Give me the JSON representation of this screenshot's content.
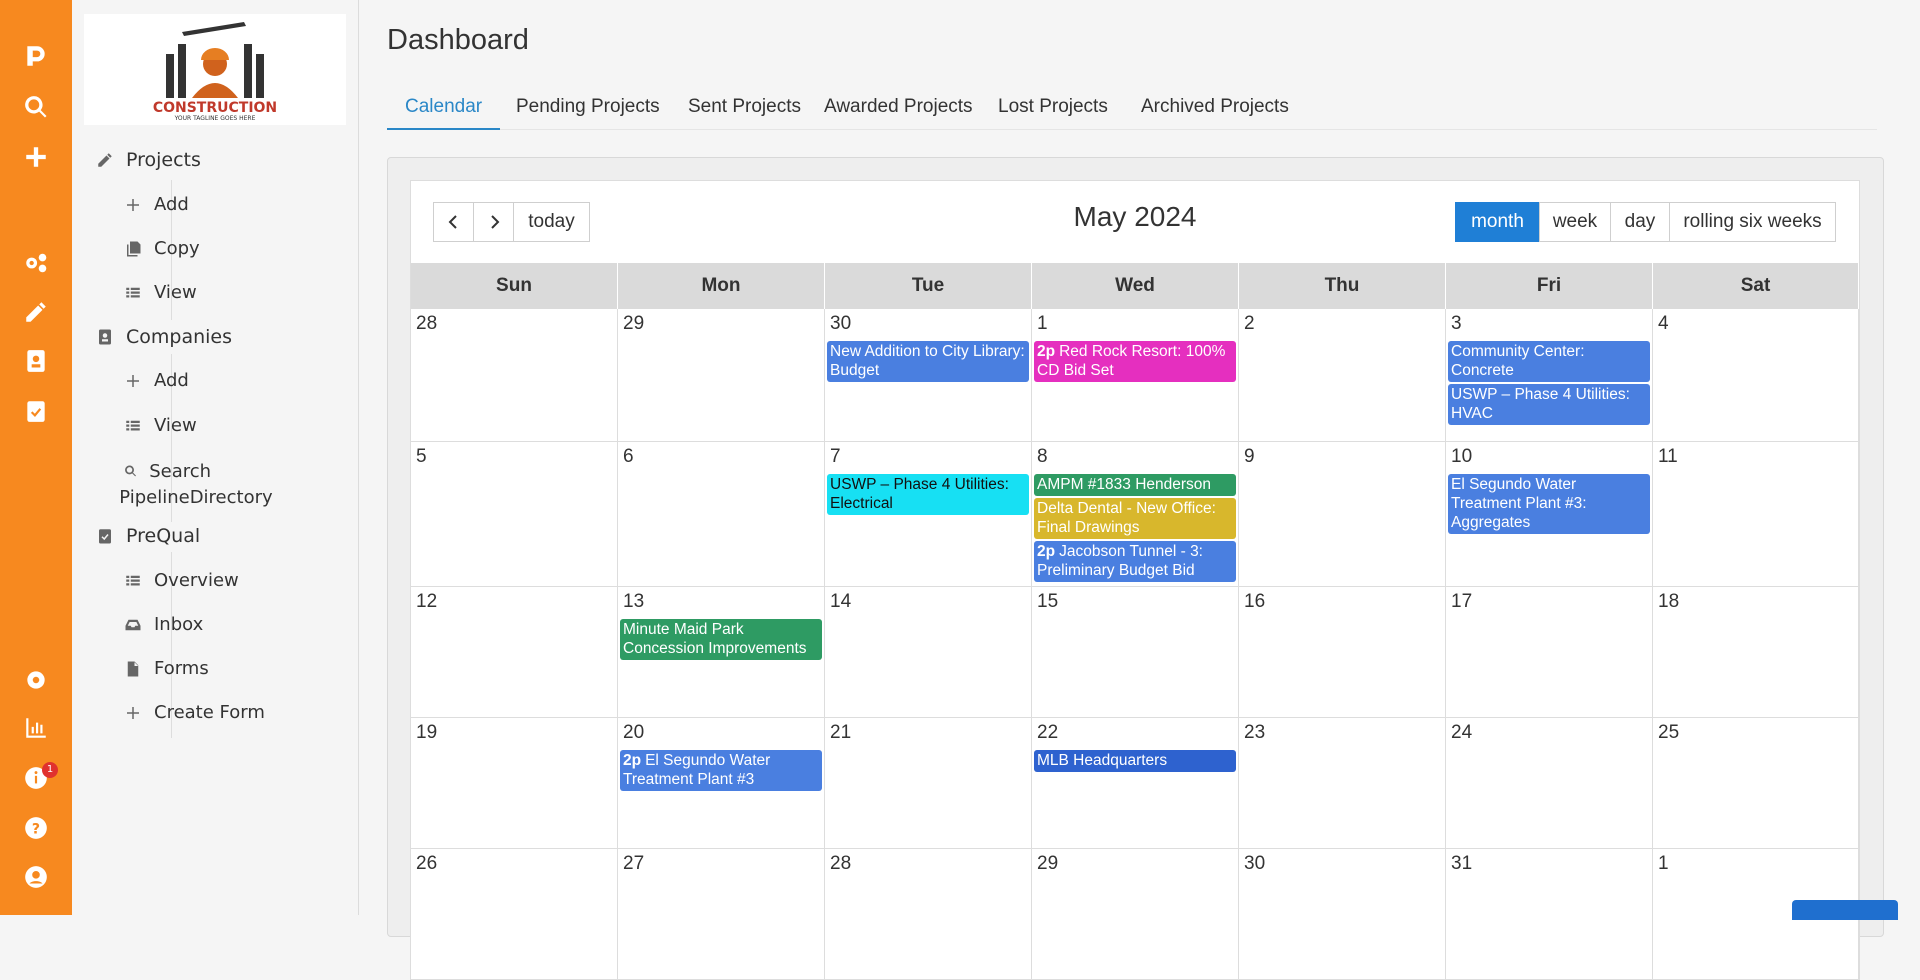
{
  "rail": {
    "icons": [
      "brand-icon",
      "search-icon",
      "plus-icon",
      "gears-icon",
      "pencil-ruler-icon",
      "contact-card-icon",
      "clipboard-check-icon",
      "settings-icon",
      "chart-icon",
      "info-icon",
      "help-icon",
      "user-icon"
    ],
    "info_badge": "1"
  },
  "logo": {
    "text": "CONSTRUCTION",
    "tagline": "YOUR TAGLINE GOES HERE"
  },
  "nav": {
    "projects": "Projects",
    "projects_add": "Add",
    "projects_copy": "Copy",
    "projects_view": "View",
    "companies": "Companies",
    "companies_add": "Add",
    "companies_view": "View",
    "companies_search": "Search PipelineDirectory",
    "prequal": "PreQual",
    "prequal_overview": "Overview",
    "prequal_inbox": "Inbox",
    "prequal_forms": "Forms",
    "prequal_create": "Create Form"
  },
  "page_title": "Dashboard",
  "tabs": [
    "Calendar",
    "Pending Projects",
    "Sent Projects",
    "Awarded Projects",
    "Lost Projects",
    "Archived Projects"
  ],
  "calendar": {
    "title": "May 2024",
    "today_label": "today",
    "views": [
      "month",
      "week",
      "day",
      "rolling six weeks"
    ],
    "days_of_week": [
      "Sun",
      "Mon",
      "Tue",
      "Wed",
      "Thu",
      "Fri",
      "Sat"
    ],
    "weeks": [
      [
        "28",
        "29",
        "30",
        "1",
        "2",
        "3",
        "4"
      ],
      [
        "5",
        "6",
        "7",
        "8",
        "9",
        "10",
        "11"
      ],
      [
        "12",
        "13",
        "14",
        "15",
        "16",
        "17",
        "18"
      ],
      [
        "19",
        "20",
        "21",
        "22",
        "23",
        "24",
        "25"
      ],
      [
        "26",
        "27",
        "28",
        "29",
        "30",
        "31",
        "1"
      ]
    ],
    "events": [
      {
        "week": 0,
        "day": 2,
        "slot": 0,
        "time": "",
        "title": "New Addition to City Library: Budget",
        "color": "#4a7fe0",
        "lines": 2
      },
      {
        "week": 0,
        "day": 3,
        "slot": 0,
        "time": "2p",
        "title": "Red Rock Resort: 100% CD Bid Set",
        "color": "#e52fbf",
        "lines": 2
      },
      {
        "week": 0,
        "day": 5,
        "slot": 0,
        "time": "",
        "title": "Community Center: Concrete",
        "color": "#4a7fe0",
        "lines": 2
      },
      {
        "week": 0,
        "day": 5,
        "slot": 1,
        "time": "",
        "title": "USWP – Phase 4 Utilities: HVAC",
        "color": "#4a7fe0",
        "lines": 2
      },
      {
        "week": 1,
        "day": 2,
        "slot": 0,
        "time": "",
        "title": "USWP – Phase 4 Utilities: Electrical",
        "color": "#17e0f3",
        "lines": 2,
        "dark": true
      },
      {
        "week": 1,
        "day": 3,
        "slot": 0,
        "time": "",
        "title": "AMPM #1833 Henderson",
        "color": "#2e9b63",
        "lines": 1
      },
      {
        "week": 1,
        "day": 3,
        "slot": 1,
        "time": "",
        "title": "Delta Dental - New Office: Final Drawings",
        "color": "#d8b72c",
        "lines": 2
      },
      {
        "week": 1,
        "day": 3,
        "slot": 2,
        "time": "2p",
        "title": "Jacobson Tunnel - 3: Preliminary Budget Bid",
        "color": "#4a7fe0",
        "lines": 2
      },
      {
        "week": 1,
        "day": 5,
        "slot": 0,
        "time": "",
        "title": "El Segundo Water Treatment Plant #3: Aggregates",
        "color": "#4a7fe0",
        "lines": 3
      },
      {
        "week": 2,
        "day": 1,
        "slot": 0,
        "time": "",
        "title": "Minute Maid Park Concession Improvements",
        "color": "#2e9b63",
        "lines": 2
      },
      {
        "week": 3,
        "day": 1,
        "slot": 0,
        "time": "2p",
        "title": "El Segundo Water Treatment Plant #3",
        "color": "#4a7fe0",
        "lines": 2
      },
      {
        "week": 3,
        "day": 3,
        "slot": 0,
        "time": "",
        "title": "MLB Headquarters",
        "color": "#2e62cf",
        "lines": 1
      }
    ]
  }
}
